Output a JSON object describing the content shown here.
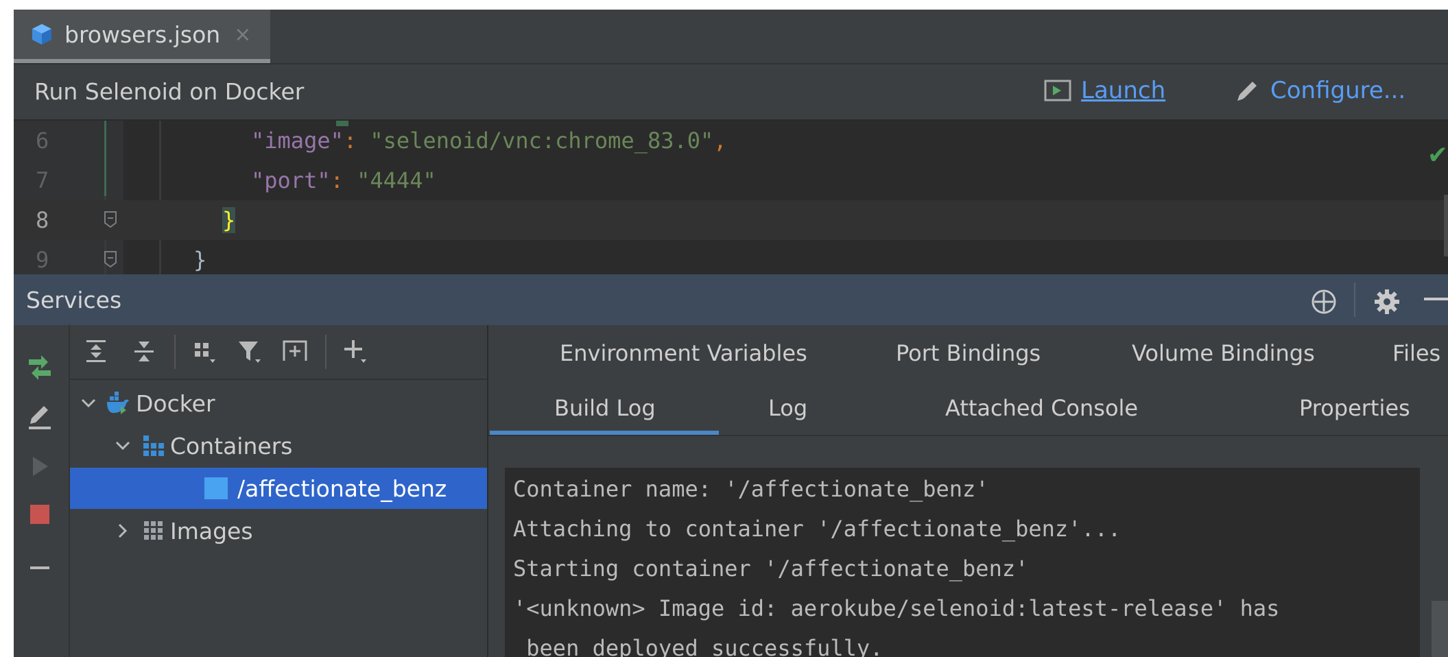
{
  "editor_tab": {
    "title": "browsers.json",
    "close": "×"
  },
  "run_bar": {
    "title": "Run Selenoid on Docker",
    "launch_label": "Launch",
    "configure_label": "Configure..."
  },
  "editor": {
    "lines": [
      {
        "num": "6",
        "key": "\"image\"",
        "colon": ": ",
        "value": "\"selenoid/vnc:chrome_83.0\"",
        "trail": ","
      },
      {
        "num": "7",
        "key": "\"port\"",
        "colon": ": ",
        "value": "\"4444\"",
        "trail": ""
      },
      {
        "num": "8",
        "brace": "}"
      },
      {
        "num": "9",
        "brace": "}"
      }
    ]
  },
  "services": {
    "title": "Services",
    "tree": {
      "docker": "Docker",
      "containers": "Containers",
      "container_item": "/affectionate_benz",
      "images": "Images"
    },
    "tabs_row1": [
      "Environment Variables",
      "Port Bindings",
      "Volume Bindings",
      "Files"
    ],
    "tabs_row2": [
      "Build Log",
      "Log",
      "Attached Console",
      "Properties"
    ],
    "active_tab": "Build Log",
    "console_lines": [
      "Container name: '/affectionate_benz'",
      "Attaching to container '/affectionate_benz'...",
      "Starting container '/affectionate_benz'",
      "'<unknown> Image id: aerokube/selenoid:latest-release' has",
      " been deployed successfully."
    ]
  },
  "colors": {
    "accent": "#589df6",
    "selection": "#2f65ca",
    "header": "#3d4b5c",
    "success": "#499c54",
    "stop": "#c75450"
  },
  "icons": {
    "file": "cube-icon",
    "launch": "run-window-icon",
    "configure": "pencil-icon",
    "services_header": [
      "crosshair-icon",
      "gear-icon",
      "minimize-icon"
    ],
    "left_toolbar": [
      "rerun-icon",
      "edit-icon",
      "run-icon",
      "stop-icon",
      "minus-icon"
    ],
    "tree_toolbar": [
      "expand-all-icon",
      "collapse-all-icon",
      "group-icon",
      "filter-icon",
      "new-tab-icon",
      "add-icon"
    ]
  }
}
